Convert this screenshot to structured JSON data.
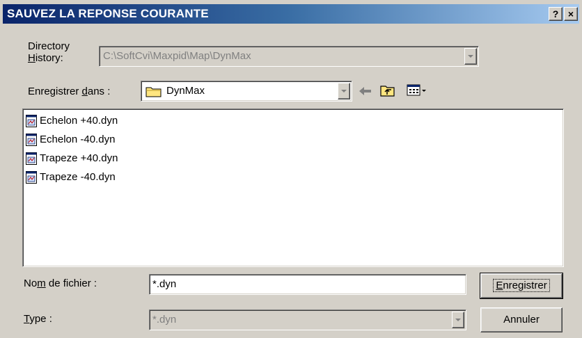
{
  "dialog": {
    "title": "SAUVEZ LA REPONSE COURANTE",
    "help_button": "?",
    "close_button": "×"
  },
  "history": {
    "label_line1": "Directory",
    "label_line2_u": "H",
    "label_line2_rest": "istory:",
    "value": "C:\\SoftCvi\\Maxpid\\Map\\DynMax"
  },
  "save_in": {
    "label_pre": "Enregistrer ",
    "label_u": "d",
    "label_post": "ans :",
    "value": "DynMax",
    "icons": [
      "folder-icon",
      "back-arrow-icon",
      "up-folder-icon",
      "view-menu-icon"
    ]
  },
  "files": [
    {
      "name": "Echelon +40.dyn",
      "icon": "dyn-file-icon"
    },
    {
      "name": "Echelon -40.dyn",
      "icon": "dyn-file-icon"
    },
    {
      "name": "Trapeze +40.dyn",
      "icon": "dyn-file-icon"
    },
    {
      "name": "Trapeze -40.dyn",
      "icon": "dyn-file-icon"
    }
  ],
  "filename": {
    "label_pre": "No",
    "label_u": "m",
    "label_post": " de fichier :",
    "value": "*.dyn"
  },
  "type": {
    "label_u": "T",
    "label_post": "ype :",
    "value": "*.dyn"
  },
  "buttons": {
    "save_u": "E",
    "save_rest": "nregistrer",
    "cancel": "Annuler"
  },
  "colors": {
    "title_gradient_start": "#0a246a",
    "title_gradient_end": "#a6caf0",
    "face": "#d4d0c8"
  }
}
